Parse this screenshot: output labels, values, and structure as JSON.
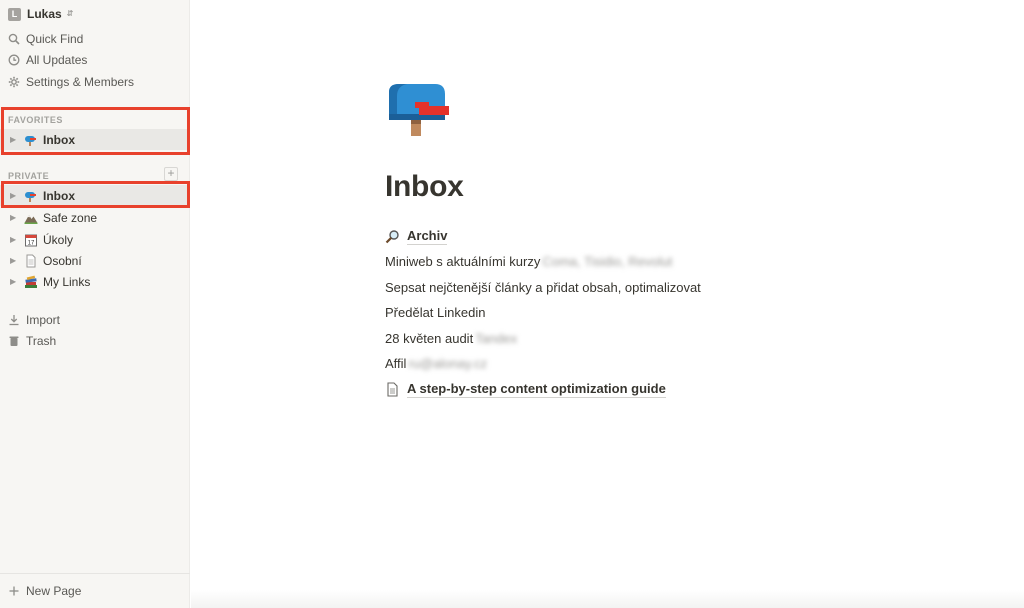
{
  "sidebar": {
    "workspace": {
      "avatar_letter": "L",
      "name": "Lukas"
    },
    "nav": [
      {
        "label": "Quick Find",
        "icon": "search-icon"
      },
      {
        "label": "All Updates",
        "icon": "clock-icon"
      },
      {
        "label": "Settings & Members",
        "icon": "gear-icon"
      }
    ],
    "favorites_label": "FAVORITES",
    "favorites": [
      {
        "label": "Inbox",
        "icon": "mailbox-icon"
      }
    ],
    "private_label": "PRIVATE",
    "private_add": "+",
    "pages": [
      {
        "label": "Inbox",
        "icon": "mailbox-icon"
      },
      {
        "label": "Safe zone",
        "icon": "mountain-icon"
      },
      {
        "label": "Úkoly",
        "icon": "calendar-icon"
      },
      {
        "label": "Osobní",
        "icon": "document-icon"
      },
      {
        "label": "My Links",
        "icon": "books-icon"
      }
    ],
    "import_label": "Import",
    "trash_label": "Trash",
    "new_page_label": "New Page"
  },
  "page": {
    "icon": "mailbox-icon",
    "title": "Inbox",
    "blocks": [
      {
        "type": "link",
        "icon": "magnifier-icon",
        "text": "Archiv"
      },
      {
        "type": "text",
        "text": "Miniweb s aktuálními kurzy",
        "blurred": "Coma, Tisidio, Revolut"
      },
      {
        "type": "text",
        "text": "Sepsat nejčtenější články a přidat  obsah, optimalizovat"
      },
      {
        "type": "text",
        "text": "Předělat Linkedin"
      },
      {
        "type": "text",
        "text": "28 květen audit",
        "blurred": "Tandex"
      },
      {
        "type": "text",
        "text": "Affil",
        "blurred": "ru@alonay.cz"
      },
      {
        "type": "link",
        "icon": "document-icon",
        "text": "A step-by-step content optimization guide"
      }
    ]
  },
  "colors": {
    "sidebar_bg": "#f7f6f3",
    "highlight": "#e8412c",
    "text": "#37352f"
  }
}
